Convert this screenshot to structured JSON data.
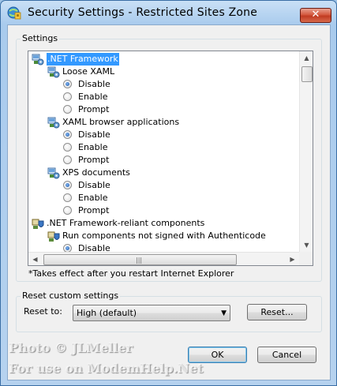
{
  "window": {
    "title": "Security Settings - Restricted Sites Zone",
    "close_label": "✕"
  },
  "settings_group": {
    "label": "Settings",
    "tree": [
      {
        "kind": "category",
        "label": ".NET Framework",
        "selected": true,
        "icon": "settings-category-icon"
      },
      {
        "kind": "subcategory",
        "label": "Loose XAML",
        "icon": "settings-category-icon"
      },
      {
        "kind": "option",
        "label": "Disable",
        "checked": true
      },
      {
        "kind": "option",
        "label": "Enable",
        "checked": false
      },
      {
        "kind": "option",
        "label": "Prompt",
        "checked": false
      },
      {
        "kind": "subcategory",
        "label": "XAML browser applications",
        "icon": "settings-category-icon"
      },
      {
        "kind": "option",
        "label": "Disable",
        "checked": true
      },
      {
        "kind": "option",
        "label": "Enable",
        "checked": false
      },
      {
        "kind": "option",
        "label": "Prompt",
        "checked": false
      },
      {
        "kind": "subcategory",
        "label": "XPS documents",
        "icon": "settings-category-icon"
      },
      {
        "kind": "option",
        "label": "Disable",
        "checked": true
      },
      {
        "kind": "option",
        "label": "Enable",
        "checked": false
      },
      {
        "kind": "option",
        "label": "Prompt",
        "checked": false
      },
      {
        "kind": "category2",
        "label": ".NET Framework-reliant components",
        "icon": "shield-settings-icon"
      },
      {
        "kind": "subcategory2",
        "label": "Run components not signed with Authenticode",
        "icon": "shield-settings-icon"
      },
      {
        "kind": "option",
        "label": "Disable",
        "checked": true
      }
    ],
    "footnote": "*Takes effect after you restart Internet Explorer"
  },
  "reset_group": {
    "label": "Reset custom settings",
    "reset_to_label": "Reset to:",
    "reset_to_value": "High (default)",
    "reset_button": "Reset..."
  },
  "buttons": {
    "ok": "OK",
    "cancel": "Cancel"
  },
  "watermark": {
    "line1": "Photo © JLMeller",
    "line2": "For use on ModemHelp.Net"
  },
  "colors": {
    "selection": "#3399ff",
    "title_bar": "#a9cbed",
    "close_button": "#c13b22"
  }
}
